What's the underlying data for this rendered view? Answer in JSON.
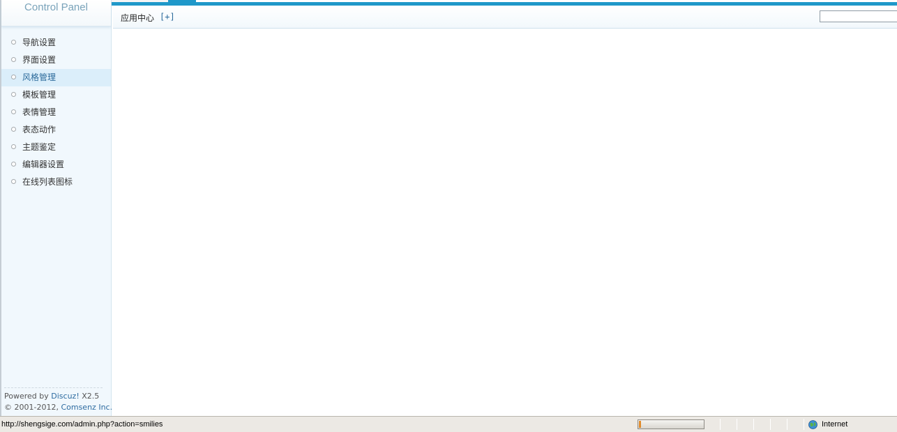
{
  "sidebar": {
    "title": "Control Panel",
    "items": [
      {
        "label": "导航设置"
      },
      {
        "label": "界面设置"
      },
      {
        "label": "风格管理"
      },
      {
        "label": "模板管理"
      },
      {
        "label": "表情管理"
      },
      {
        "label": "表态动作"
      },
      {
        "label": "主题鉴定"
      },
      {
        "label": "编辑器设置"
      },
      {
        "label": "在线列表图标"
      }
    ],
    "active_index": 2,
    "footer": {
      "powered_prefix": "Powered by",
      "product_link": "Discuz!",
      "version": "X2.5",
      "copyright_prefix": "© 2001-2012,",
      "company_link": "Comsenz Inc."
    }
  },
  "header": {
    "app_center_label": "应用中心",
    "add_label": "[+]",
    "search_value": ""
  },
  "statusbar": {
    "url": "http://shengsige.com/admin.php?action=smilies",
    "progress": 0.03,
    "zone_icon": "globe-icon",
    "zone_label": "Internet"
  },
  "colors": {
    "accent": "#1f98c9",
    "active_item_bg": "#dbeefa",
    "link": "#2b6a9b",
    "progress_fill": "#e08b2c"
  }
}
